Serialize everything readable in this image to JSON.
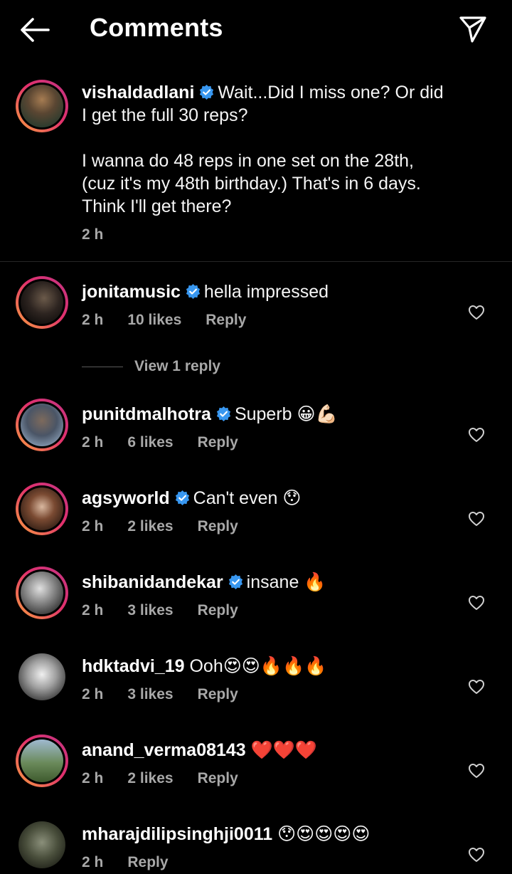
{
  "header": {
    "title": "Comments",
    "back_icon": "arrow-left-icon",
    "share_icon": "paper-plane-icon"
  },
  "caption": {
    "username": "vishaldadlani",
    "verified": true,
    "text_line1": "Wait...Did I miss one? Or did",
    "text_line2": "I get the full 30 reps?",
    "text_line3": "I wanna do 48 reps in one set on the 28th,",
    "text_line4": "(cuz it's my 48th birthday.) That's in 6 days.",
    "text_line5": "Think I'll get there?",
    "time": "2 h"
  },
  "comments": [
    {
      "username": "jonitamusic",
      "verified": true,
      "text": "hella impressed",
      "time": "2 h",
      "likes": "10 likes",
      "reply": "Reply"
    },
    {
      "username": "punitdmalhotra",
      "verified": true,
      "text": "Superb 😀💪🏻",
      "time": "2 h",
      "likes": "6 likes",
      "reply": "Reply"
    },
    {
      "username": "agsyworld",
      "verified": true,
      "text": "Can't even 😯",
      "time": "2 h",
      "likes": "2 likes",
      "reply": "Reply"
    },
    {
      "username": "shibanidandekar",
      "verified": true,
      "text": "insane 🔥",
      "time": "2 h",
      "likes": "3 likes",
      "reply": "Reply"
    },
    {
      "username": "hdktadvi_19",
      "verified": false,
      "text": "Ooh😍😍🔥🔥🔥",
      "time": "2 h",
      "likes": "3 likes",
      "reply": "Reply"
    },
    {
      "username": "anand_verma08143",
      "verified": false,
      "text": "❤️❤️❤️",
      "time": "2 h",
      "likes": "2 likes",
      "reply": "Reply"
    },
    {
      "username": "mharajdilipsinghji0011",
      "verified": false,
      "text": "😯😍😍😍😍",
      "time": "2 h",
      "likes": "",
      "reply": "Reply"
    }
  ],
  "view_replies": "View 1 reply",
  "colors": {
    "background": "#000000",
    "text_primary": "#f5f5f5",
    "text_secondary": "#a8a8a8",
    "verified_blue": "#3897f0",
    "story_ring_start": "#f9a03f",
    "story_ring_end": "#c13584"
  },
  "icons": {
    "verified": "verified-badge-icon",
    "like": "heart-outline-icon"
  }
}
